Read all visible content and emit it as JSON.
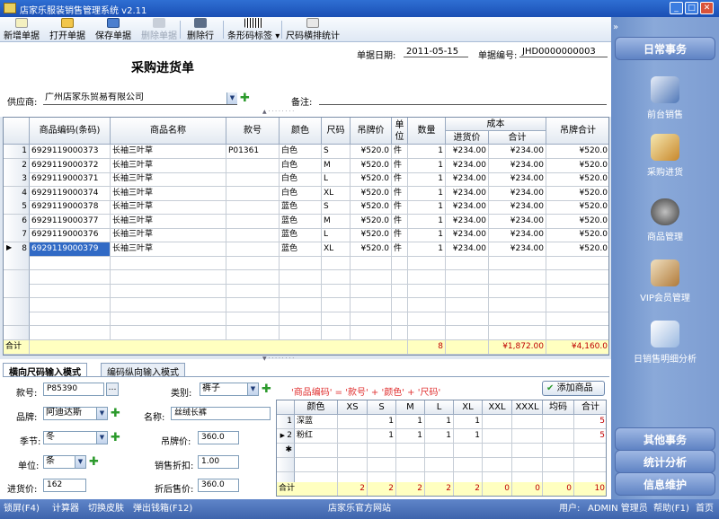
{
  "window": {
    "title": "店家乐服装销售管理系统 v2.11"
  },
  "toolbar": {
    "new": "新增单据",
    "open": "打开单据",
    "save": "保存单据",
    "delete_doc": "删除单据",
    "delete_row": "删除行",
    "barcode": "条形码标签",
    "size_stats": "尺码横排统计"
  },
  "form": {
    "title": "采购进货单",
    "date_label": "单据日期:",
    "date": "2011-05-15",
    "docno_label": "单据编号:",
    "docno": "JHD0000000003",
    "supplier_label": "供应商:",
    "supplier": "广州店家乐贸易有限公司",
    "remark_label": "备注:",
    "remark": ""
  },
  "grid": {
    "headers": {
      "code": "商品编码(条码)",
      "name": "商品名称",
      "style": "款号",
      "color": "颜色",
      "size": "尺码",
      "tag_price": "吊牌价",
      "unit": "单位",
      "qty": "数量",
      "cost": "成本",
      "cost_price": "进货价",
      "cost_total": "合计",
      "tag_total": "吊牌合计"
    },
    "rows": [
      {
        "n": "1",
        "code": "6929119000373",
        "name": "长袖三叶草",
        "style": "P01361",
        "color": "白色",
        "size": "S",
        "price": "¥520.0",
        "unit": "件",
        "qty": "1",
        "cp": "¥234.00",
        "ct": "¥234.00",
        "tt": "¥520.0"
      },
      {
        "n": "2",
        "code": "6929119000372",
        "name": "长袖三叶草",
        "style": "",
        "color": "白色",
        "size": "M",
        "price": "¥520.0",
        "unit": "件",
        "qty": "1",
        "cp": "¥234.00",
        "ct": "¥234.00",
        "tt": "¥520.0"
      },
      {
        "n": "3",
        "code": "6929119000371",
        "name": "长袖三叶草",
        "style": "",
        "color": "白色",
        "size": "L",
        "price": "¥520.0",
        "unit": "件",
        "qty": "1",
        "cp": "¥234.00",
        "ct": "¥234.00",
        "tt": "¥520.0"
      },
      {
        "n": "4",
        "code": "6929119000374",
        "name": "长袖三叶草",
        "style": "",
        "color": "白色",
        "size": "XL",
        "price": "¥520.0",
        "unit": "件",
        "qty": "1",
        "cp": "¥234.00",
        "ct": "¥234.00",
        "tt": "¥520.0"
      },
      {
        "n": "5",
        "code": "6929119000378",
        "name": "长袖三叶草",
        "style": "",
        "color": "蓝色",
        "size": "S",
        "price": "¥520.0",
        "unit": "件",
        "qty": "1",
        "cp": "¥234.00",
        "ct": "¥234.00",
        "tt": "¥520.0"
      },
      {
        "n": "6",
        "code": "6929119000377",
        "name": "长袖三叶草",
        "style": "",
        "color": "蓝色",
        "size": "M",
        "price": "¥520.0",
        "unit": "件",
        "qty": "1",
        "cp": "¥234.00",
        "ct": "¥234.00",
        "tt": "¥520.0"
      },
      {
        "n": "7",
        "code": "6929119000376",
        "name": "长袖三叶草",
        "style": "",
        "color": "蓝色",
        "size": "L",
        "price": "¥520.0",
        "unit": "件",
        "qty": "1",
        "cp": "¥234.00",
        "ct": "¥234.00",
        "tt": "¥520.0"
      },
      {
        "n": "8",
        "code": "6929119000379",
        "name": "长袖三叶草",
        "style": "",
        "color": "蓝色",
        "size": "XL",
        "price": "¥520.0",
        "unit": "件",
        "qty": "1",
        "cp": "¥234.00",
        "ct": "¥234.00",
        "tt": "¥520.0"
      }
    ],
    "total_label": "合计",
    "total_qty": "8",
    "total_cost": "¥1,872.00",
    "total_tag": "¥4,160.0"
  },
  "tabs": {
    "horizontal": "横向尺码输入模式",
    "vertical": "编码纵向输入模式"
  },
  "entry": {
    "style_label": "款号:",
    "style": "P85390",
    "brand_label": "品牌:",
    "brand": "阿迪达斯",
    "season_label": "季节:",
    "season": "冬",
    "unit_label": "单位:",
    "unit": "条",
    "cost_label": "进货价:",
    "cost": "162",
    "category_label": "类别:",
    "category": "裤子",
    "name_label": "名称:",
    "name": "丝绒长裤",
    "tag_label": "吊牌价:",
    "tag": "360.0",
    "discount_label": "销售折扣:",
    "discount": "1.00",
    "after_label": "折后售价:",
    "after": "360.0",
    "formula": "'商品编码' = '款号' + '颜色' + '尺码'",
    "add_btn": "添加商品"
  },
  "sizegrid": {
    "headers": [
      "颜色",
      "XS",
      "S",
      "M",
      "L",
      "XL",
      "XXL",
      "XXXL",
      "均码",
      "合计"
    ],
    "rows": [
      {
        "n": "1",
        "vals": [
          "深蓝",
          "",
          "1",
          "1",
          "1",
          "1",
          "",
          "",
          "",
          ""
        ],
        "total": "5"
      },
      {
        "n": "2",
        "vals": [
          "粉红",
          "",
          "1",
          "1",
          "1",
          "1",
          "",
          "",
          "",
          ""
        ],
        "total": "5"
      },
      {
        "n": "3",
        "vals": [
          "",
          "",
          "",
          "",
          "",
          "",
          "",
          "",
          "",
          ""
        ],
        "total": ""
      }
    ],
    "total_label": "合计",
    "totals": [
      "2",
      "2",
      "2",
      "2",
      "2",
      "0",
      "0",
      "0",
      "10"
    ]
  },
  "sidebar": {
    "daily": "日常事务",
    "items": [
      "前台销售",
      "采购进货",
      "商品管理",
      "VIP会员管理",
      "日销售明细分析"
    ],
    "other": "其他事务",
    "stats": "统计分析",
    "info": "信息维护"
  },
  "status": {
    "lock": "锁屏(F4)",
    "calc": "计算器",
    "skin": "切换皮肤",
    "cashbox": "弹出钱箱(F12)",
    "site": "店家乐官方网站",
    "user": "用户:",
    "user_name": "ADMIN 管理员",
    "help": "帮助(F1)",
    "home": "首页"
  },
  "colors": {
    "accent": "#316ac5",
    "total_bg": "#ffffc0",
    "formula": "#e03030",
    "sidebar": "#7d9dd2"
  }
}
